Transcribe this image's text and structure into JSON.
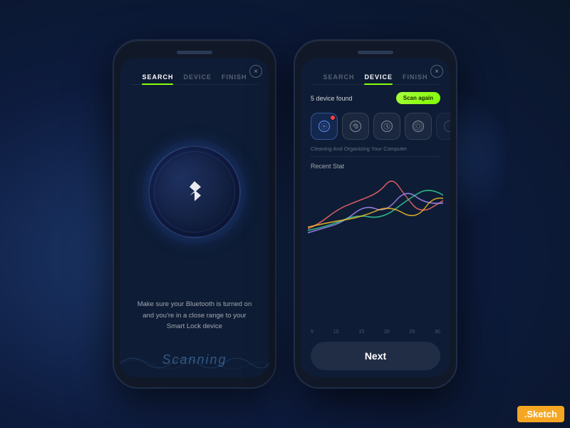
{
  "background": "#1a2a4a",
  "sketch_badge": ".Sketch",
  "phone1": {
    "tabs": [
      {
        "label": "SEARCH",
        "active": true
      },
      {
        "label": "DEVICE",
        "active": false
      },
      {
        "label": "FINISH",
        "active": false
      }
    ],
    "close_label": "×",
    "bt_icon": "✱",
    "body_text": "Make sure your Bluetooth is turned on and you're in a close range to your Smart Lock device",
    "scanning_label": "Scanning"
  },
  "phone2": {
    "tabs": [
      {
        "label": "SEARCH",
        "active": false
      },
      {
        "label": "DEVICE",
        "active": true
      },
      {
        "label": "FINISH",
        "active": false
      }
    ],
    "close_label": "×",
    "device_found": "5 device found",
    "scan_again": "Scan again",
    "cleaning_text": "Cleaning And Organizing Your Computer",
    "recent_stat_label": "Recent Stat",
    "chart_labels": [
      "5",
      "10",
      "15",
      "20",
      "25",
      "30"
    ],
    "next_label": "Next"
  }
}
